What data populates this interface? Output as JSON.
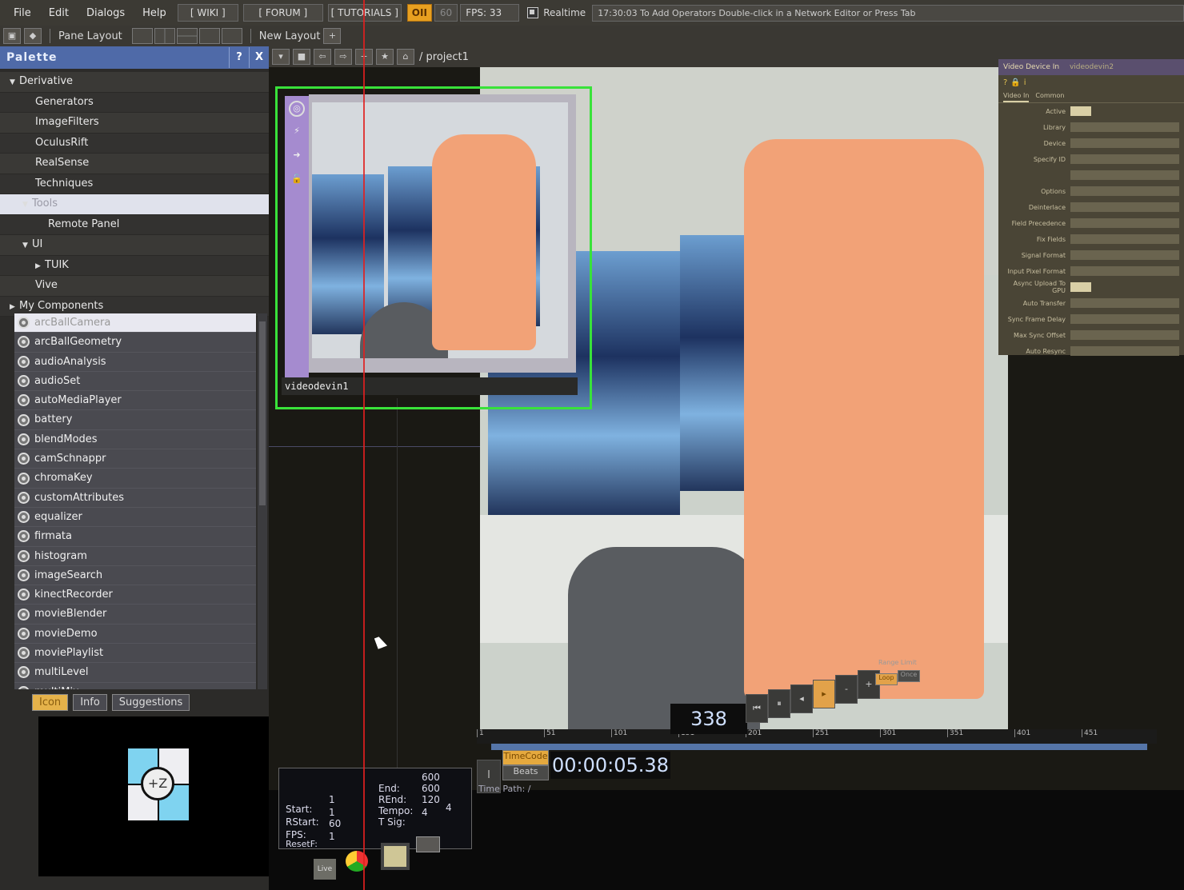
{
  "menubar": {
    "items": [
      "File",
      "Edit",
      "Dialogs",
      "Help"
    ],
    "wiki": "[ WIKI ]",
    "forum": "[ FORUM ]",
    "tutorials": "[ TUTORIALS ]",
    "oi_button": "OII",
    "fps_cap": "60",
    "fps_readout": "FPS: 33",
    "realtime_label": "Realtime",
    "realtime_checked": true,
    "status_message": "17:30:03 To Add Operators Double-click in a Network Editor or Press Tab"
  },
  "toolbar": {
    "pane_layout_label": "Pane Layout",
    "new_layout_label": "New Layout",
    "add_icon": "+"
  },
  "palette": {
    "title": "Palette",
    "help_label": "?",
    "close_label": "X",
    "tree": [
      {
        "label": "Derivative",
        "level": 0,
        "expanded": true
      },
      {
        "label": "Generators",
        "level": 2
      },
      {
        "label": "ImageFilters",
        "level": 2
      },
      {
        "label": "OculusRift",
        "level": 2
      },
      {
        "label": "RealSense",
        "level": 2
      },
      {
        "label": "Techniques",
        "level": 2
      },
      {
        "label": "Tools",
        "level": 1,
        "expanded": true,
        "selected": true
      },
      {
        "label": "Remote Panel",
        "level": 3
      },
      {
        "label": "UI",
        "level": 1,
        "expanded": true
      },
      {
        "label": "TUIK",
        "level": 2,
        "collapsed": true
      },
      {
        "label": "Vive",
        "level": 2
      },
      {
        "label": "My Components",
        "level": 0,
        "collapsed": true
      }
    ],
    "components": [
      "arcBallCamera",
      "arcBallGeometry",
      "audioAnalysis",
      "audioSet",
      "autoMediaPlayer",
      "battery",
      "blendModes",
      "camSchnappr",
      "chromaKey",
      "customAttributes",
      "equalizer",
      "firmata",
      "histogram",
      "imageSearch",
      "kinectRecorder",
      "movieBlender",
      "movieDemo",
      "moviePlaylist",
      "multiLevel",
      "multiMix"
    ],
    "selected_component": "arcBallCamera",
    "tabs": [
      "Icon",
      "Info",
      "Suggestions"
    ],
    "active_tab": "Icon",
    "preview_icon_text": "+Z"
  },
  "network": {
    "path": "/ project1",
    "node_name": "videodevin1"
  },
  "params": {
    "op_type": "Video Device In",
    "op_name": "videodevin2",
    "tabs": [
      "Video In",
      "Common"
    ],
    "rows": [
      "Active",
      "Library",
      "Device",
      "Specify ID",
      "",
      "Options",
      "Deinterlace",
      "Field Precedence",
      "Fix Fields",
      "Signal Format",
      "Input Pixel Format",
      "Async Upload To GPU",
      "Auto Transfer",
      "Sync Frame Delay",
      "Max Sync Offset",
      "Auto Resync"
    ]
  },
  "timeline": {
    "ticks": [
      "1",
      "51",
      "101",
      "151",
      "201",
      "251",
      "301",
      "351",
      "401",
      "451"
    ],
    "timecode": "00:00:05.38",
    "frame": "338",
    "mode_timecode": "TimeCode",
    "mode_beats": "Beats",
    "time_path": "Time Path: /",
    "range_limit_label": "Range Limit",
    "loop_label": "Loop",
    "once_label": "Once"
  },
  "range_info": {
    "start_label": "Start:",
    "start": "1",
    "rstart_label": "RStart:",
    "rstart": "1",
    "fps_label": "FPS:",
    "fps": "60",
    "resetf_label": "ResetF:",
    "resetf": "1",
    "end_label": "End:",
    "end": "600",
    "rend_label": "REnd:",
    "rend": "600",
    "tempo_label": "Tempo:",
    "tempo": "120",
    "tsig_label": "T Sig:",
    "tsig_num": "4",
    "tsig_den": "4"
  },
  "taskbar": {
    "apps": [
      "live-app",
      "chrome",
      "touchdesigner",
      "window"
    ],
    "live_label": "Live"
  },
  "colors": {
    "palette_header": "#4f6aa8",
    "node_selected": "#39e23a",
    "playhead": "#e02020",
    "accent_orange": "#e8a020"
  }
}
